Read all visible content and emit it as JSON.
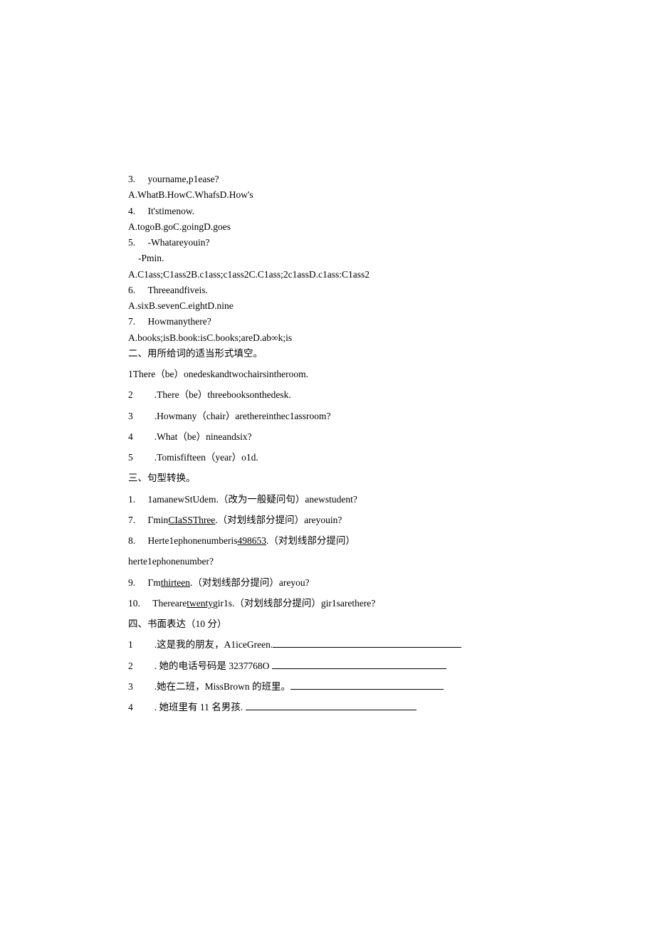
{
  "q3": {
    "num": "3.",
    "text": "yourname,p1ease?",
    "opts": "A.WhatB.HowC.WhafsD.How's"
  },
  "q4": {
    "num": "4.",
    "text": "It'stimenow.",
    "opts": "A.togoB.goC.goingD.goes"
  },
  "q5": {
    "num": "5.",
    "text": "-Whatareyouin?",
    "text2": "-Pmin.",
    "opts": "A.C1ass;C1ass2B.c1ass;c1ass2C.C1ass;2c1assD.c1ass:C1ass2"
  },
  "q6": {
    "num": "6.",
    "text": "Threeandfiveis.",
    "opts": "A.sixB.sevenC.eightD.nine"
  },
  "q7": {
    "num": "7.",
    "text": "Howmanythere?",
    "opts": "A.books;isB.book:isC.books;areD.ab∞k;is"
  },
  "sec2": {
    "title": "二、用所给词的适当形式填空。",
    "i1": "1There（be）onedeskandtwochairsintheroom.",
    "i2n": "2",
    "i2": ".There（be）threebooksonthedesk.",
    "i3n": "3",
    "i3": ".Howmany（chair）arethereinthec1assroom?",
    "i4n": "4",
    "i4": ".What（be）nineandsix?",
    "i5n": "5",
    "i5": ".Tomisfifteen（year）o1d."
  },
  "sec3": {
    "title": "三、句型转换。",
    "i1": {
      "num": "1.",
      "text": "1amanewStUdem.（改为一般疑问句）anewstudent?"
    },
    "i7": {
      "num": "7.",
      "pre": "Γmin",
      "u": "CIaSSThree",
      "post": ".（对划线部分提问）areyouin?"
    },
    "i8": {
      "num": "8.",
      "pre": "Herte1ephonenumberis",
      "u": "498653",
      "post": ".（对划线部分提问）"
    },
    "i8b": "herte1ephonenumber?",
    "i9": {
      "num": "9.",
      "pre": "Γm",
      "u": "thirteen",
      "post": ".（对划线部分提问）areyou?"
    },
    "i10": {
      "num": "10.",
      "pre": "Thereare",
      "u": "twenty",
      "post": "gir1s.（对划线部分提问）gir1sarethere?"
    }
  },
  "sec4": {
    "title": "四、书面表达（10 分）",
    "i1n": "1",
    "i1": ".这是我的朋友，A1iceGreen.",
    "i2n": "2",
    "i2": ". 她的电话号码是 3237768O ",
    "i3n": "3",
    "i3": ".她在二班，MissBrown 的班里。",
    "i4n": "4",
    "i4": ". 她班里有 11 名男孩. "
  }
}
